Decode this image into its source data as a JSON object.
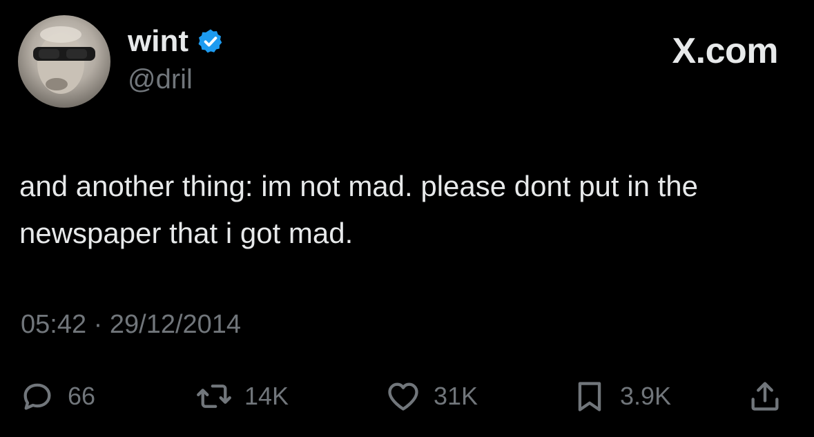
{
  "author": {
    "display_name": "wint",
    "handle": "@dril",
    "verified": true
  },
  "brand": "X.com",
  "tweet": {
    "text": "and another thing: im not mad. please dont put in the newspaper that i got mad.",
    "timestamp": "05:42 · 29/12/2014"
  },
  "actions": {
    "replies": "66",
    "reposts": "14K",
    "likes": "31K",
    "bookmarks": "3.9K"
  },
  "icons": {
    "reply": "reply-bubble-icon",
    "repost": "repost-arrows-icon",
    "like": "heart-icon",
    "bookmark": "bookmark-icon",
    "share": "share-upload-icon",
    "verified": "verified-badge-icon"
  },
  "colors": {
    "background": "#000000",
    "text": "#e7e9ea",
    "muted": "#71767b",
    "verified_blue": "#1d9bf0"
  }
}
